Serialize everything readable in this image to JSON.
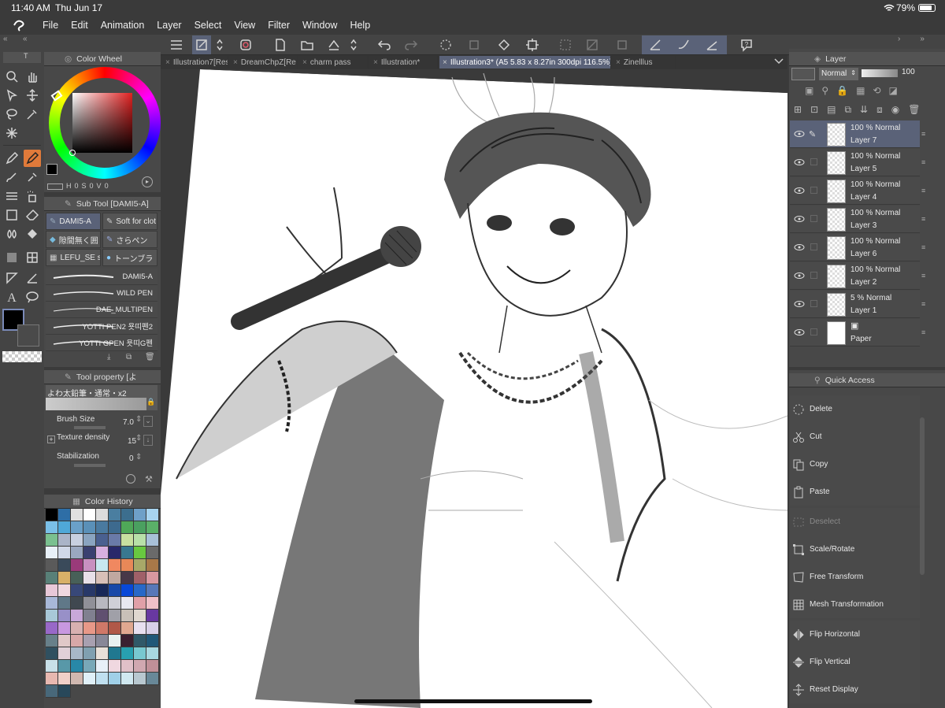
{
  "status": {
    "time": "11:40 AM",
    "date": "Thu Jun 17",
    "battery": "79%"
  },
  "menu": [
    "File",
    "Edit",
    "Animation",
    "Layer",
    "Select",
    "View",
    "Filter",
    "Window",
    "Help"
  ],
  "tabs": [
    {
      "label": "Illustration7[Res",
      "active": false
    },
    {
      "label": "DreamChpZ[Re",
      "active": false
    },
    {
      "label": "charm pass",
      "active": false
    },
    {
      "label": "Illustration*",
      "active": false
    },
    {
      "label": "Illustration3* (A5 5.83 x 8.27in 300dpi 116.5%)",
      "active": true
    },
    {
      "label": "Zinelllus",
      "active": false
    }
  ],
  "color_wheel": {
    "title": "Color Wheel",
    "fields": {
      "h_label": "H",
      "h": "0",
      "s_label": "S",
      "s": "0",
      "v_label": "V",
      "v": "0"
    },
    "main_color": "#000000",
    "sub_color": "#ffffff"
  },
  "subtool": {
    "title": "Sub Tool [DAMI5-A]",
    "items": [
      "DAMI5-A",
      "Soft for clot",
      "隙間無く囲",
      "さらペン",
      "LEFU_SE s",
      "トーンブラ"
    ],
    "brushes": [
      "DAMI5-A",
      "WILD PEN",
      "DAE_MULTIPEN",
      "YOTTI PEN2 욧띠펜2",
      "YOTTI GPEN 욧띠G펜"
    ]
  },
  "tool_property": {
    "title": "Tool property [よ",
    "preset": "よわ太鉛筆・通常・x2",
    "brush_size_label": "Brush Size",
    "brush_size": "7.0",
    "texture_density_label": "Texture density",
    "texture_density": "15",
    "stabilization_label": "Stabilization",
    "stabilization": "0"
  },
  "color_history": {
    "title": "Color History",
    "swatches": [
      "#000000",
      "#2e6ea6",
      "#e0e0e0",
      "#ffffff",
      "#dcdcdc",
      "#4a7ea0",
      "#3c6e8e",
      "#6fa0c8",
      "#a8d4f0",
      "#7ac0e8",
      "#4fa8d8",
      "#6aa0c8",
      "#5a90b8",
      "#4a7aa0",
      "#3d6a8e",
      "#4fa858",
      "#4aa060",
      "#5ab068",
      "#7ac090",
      "#aab4c8",
      "#c8d0e0",
      "#8aa4c0",
      "#4a6090",
      "#6a7aa8",
      "#c8e0a0",
      "#b8e0a8",
      "#a8c0d8",
      "#e8f0f8",
      "#d0d8e8",
      "#9aa8c0",
      "#3a4070",
      "#d8b0e0",
      "#28286a",
      "#387890",
      "#68c840",
      "#6a6a6a",
      "#5a5a5a",
      "#3a4a5a",
      "#9a3a7a",
      "#c890c0",
      "#c8e8f0",
      "#f08860",
      "#e88858",
      "#a8a868",
      "#a87848",
      "#588078",
      "#d8b068",
      "#486058",
      "#e8e0e8",
      "#d8c0b8",
      "#c0a8a0",
      "#483848",
      "#a06068",
      "#d898a0",
      "#e8c8d8",
      "#f0d8e0",
      "#384878",
      "#283868",
      "#182858",
      "#1848a8",
      "#0848d8",
      "#2868c8",
      "#5878b8",
      "#a8b8d8",
      "#607888",
      "#404850",
      "#909098",
      "#b8b8c0",
      "#d0d0d8",
      "#e8e8f0",
      "#e0a0a8",
      "#f0c0c8",
      "#a8c8d8",
      "#9890c8",
      "#c8a8d8",
      "#808090",
      "#605070",
      "#a0a0a8",
      "#c8c0b8",
      "#e0d8d0",
      "#6838a0",
      "#9868c8",
      "#c898e0",
      "#d8b0b0",
      "#e89888",
      "#d07868",
      "#b05848",
      "#e0a890",
      "#e8e0f0",
      "#d8d0e8",
      "#68808a",
      "#e0c8c8",
      "#d8a8a8",
      "#a8a0b0",
      "#888898",
      "#e8f0f0",
      "#3a2030",
      "#305868",
      "#205878",
      "#305060",
      "#e0d0d8",
      "#a8b8c8",
      "#80a0b0",
      "#e8e0d8",
      "#207890",
      "#28a0b0",
      "#78c8d0",
      "#a8d8e0",
      "#c8e0e8",
      "#5898a8",
      "#2888a8",
      "#78a8b8",
      "#e8f0f8",
      "#f0d8e0",
      "#e0c0c8",
      "#d0a8b0",
      "#c09098",
      "#e8b8b0",
      "#f0d0c8",
      "#d0b8b0",
      "#e0f0f8",
      "#c0e0f0",
      "#a0d0e8",
      "#d0e8f0",
      "#b8c8d0",
      "#688898",
      "#48687a",
      "#28485a"
    ]
  },
  "layers": {
    "title": "Layer",
    "blend_mode": "Normal",
    "opacity": "100",
    "rows": [
      {
        "mode": "100 % Normal",
        "name": "Layer 7",
        "selected": true
      },
      {
        "mode": "100 % Normal",
        "name": "Layer 5",
        "selected": false
      },
      {
        "mode": "100 % Normal",
        "name": "Layer 4",
        "selected": false
      },
      {
        "mode": "100 % Normal",
        "name": "Layer 3",
        "selected": false
      },
      {
        "mode": "100 % Normal",
        "name": "Layer 6",
        "selected": false
      },
      {
        "mode": "100 % Normal",
        "name": "Layer 2",
        "selected": false
      },
      {
        "mode": "5 % Normal",
        "name": "Layer 1",
        "selected": false
      },
      {
        "mode": "",
        "name": "Paper",
        "selected": false
      }
    ]
  },
  "quick_access": {
    "title": "Quick Access",
    "items": [
      {
        "label": "Delete",
        "icon": "delete-icon",
        "enabled": true
      },
      {
        "label": "Cut",
        "icon": "scissors-icon",
        "enabled": true
      },
      {
        "label": "Copy",
        "icon": "copy-icon",
        "enabled": true
      },
      {
        "label": "Paste",
        "icon": "paste-icon",
        "enabled": true
      },
      {
        "label": "Deselect",
        "icon": "deselect-icon",
        "enabled": false
      },
      {
        "label": "Scale/Rotate",
        "icon": "scale-rotate-icon",
        "enabled": true
      },
      {
        "label": "Free Transform",
        "icon": "free-transform-icon",
        "enabled": true
      },
      {
        "label": "Mesh Transformation",
        "icon": "mesh-transform-icon",
        "enabled": true
      },
      {
        "label": "Flip Horizontal",
        "icon": "flip-horizontal-icon",
        "enabled": true
      },
      {
        "label": "Flip Vertical",
        "icon": "flip-vertical-icon",
        "enabled": true
      },
      {
        "label": "Reset Display",
        "icon": "reset-display-icon",
        "enabled": true
      }
    ]
  }
}
